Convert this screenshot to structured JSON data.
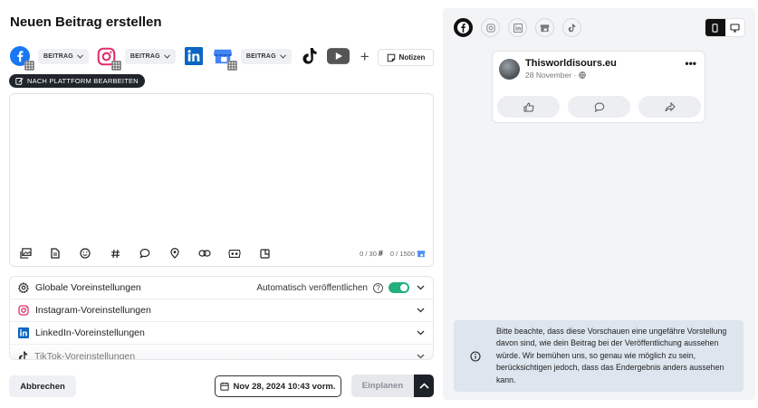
{
  "page": {
    "title": "Neuen Beitrag erstellen"
  },
  "platforms": {
    "facebook_type": "BEITRAG",
    "instagram_type": "BEITRAG",
    "gmb_type": "BEITRAG",
    "add_label": "+"
  },
  "notes_label": "Notizen",
  "edit_per_platform_label": "NACH PLATTFORM BEARBEITEN",
  "editor": {
    "text": "",
    "hashtag_count": "0 / 30",
    "char_count": "0 / 1500"
  },
  "settings": {
    "global_label": "Globale Voreinstellungen",
    "auto_publish_label": "Automatisch veröffentlichen",
    "auto_publish_on": true,
    "instagram_label": "Instagram-Voreinstellungen",
    "linkedin_label": "LinkedIn-Voreinstellungen",
    "tiktok_label": "TikTok-Voreinstellungen"
  },
  "footer": {
    "cancel_label": "Abbrechen",
    "date_label": "Nov 28, 2024 10:43 vorm.",
    "schedule_label": "Einplanen"
  },
  "preview": {
    "page_name": "Thisworldisours.eu",
    "post_date": "28 November ·",
    "notice": "Bitte beachte, dass diese Vorschauen eine ungefähre Vorstellung davon sind, wie dein Beitrag bei der Veröffentlichung aussehen würde. Wir bemühen uns, so genau wie möglich zu sein, berücksichtigen jedoch, dass das Endergebnis anders aussehen kann."
  },
  "colors": {
    "facebook": "#1877F2",
    "instagram": "#E1306C",
    "linkedin": "#0A66C2",
    "gmb": "#4285F4",
    "youtube": "#555555",
    "toggle_on": "#22B07D",
    "notice_bg": "#DDE5EE",
    "dark": "#1D2128"
  }
}
